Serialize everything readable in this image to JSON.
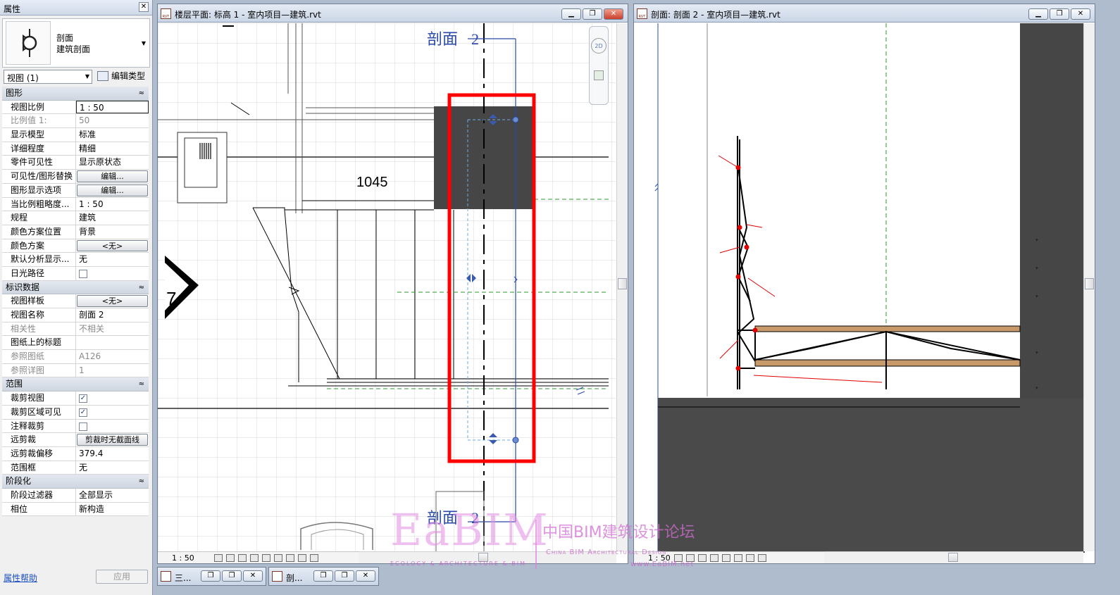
{
  "properties": {
    "title": "属性",
    "type_name_1": "剖面",
    "type_name_2": "建筑剖面",
    "filter": "视图 (1)",
    "edit_type": "编辑类型",
    "sections": [
      {
        "title": "图形",
        "rows": [
          {
            "k": "视图比例",
            "v": "1 : 50",
            "style": "box"
          },
          {
            "k": "比例值 1:",
            "v": "50",
            "style": "dim"
          },
          {
            "k": "显示模型",
            "v": "标准"
          },
          {
            "k": "详细程度",
            "v": "精细"
          },
          {
            "k": "零件可见性",
            "v": "显示原状态"
          },
          {
            "k": "可见性/图形替换",
            "v": "编辑...",
            "style": "btn"
          },
          {
            "k": "图形显示选项",
            "v": "编辑...",
            "style": "btn"
          },
          {
            "k": "当比例粗略度...",
            "v": "1 : 50"
          },
          {
            "k": "规程",
            "v": "建筑"
          },
          {
            "k": "颜色方案位置",
            "v": "背景"
          },
          {
            "k": "颜色方案",
            "v": "<无>",
            "style": "btn"
          },
          {
            "k": "默认分析显示...",
            "v": "无"
          },
          {
            "k": "日光路径",
            "v": "",
            "style": "chk"
          }
        ]
      },
      {
        "title": "标识数据",
        "rows": [
          {
            "k": "视图样板",
            "v": "<无>",
            "style": "btn"
          },
          {
            "k": "视图名称",
            "v": "剖面 2"
          },
          {
            "k": "相关性",
            "v": "不相关",
            "style": "dim"
          },
          {
            "k": "图纸上的标题",
            "v": ""
          },
          {
            "k": "参照图纸",
            "v": "A126",
            "style": "dim"
          },
          {
            "k": "参照详图",
            "v": "1",
            "style": "dim"
          }
        ]
      },
      {
        "title": "范围",
        "rows": [
          {
            "k": "裁剪视图",
            "v": "✓",
            "style": "chk"
          },
          {
            "k": "裁剪区域可见",
            "v": "✓",
            "style": "chk"
          },
          {
            "k": "注释裁剪",
            "v": "",
            "style": "chk"
          },
          {
            "k": "远剪裁",
            "v": "剪裁时无截面线",
            "style": "btn"
          },
          {
            "k": "远剪裁偏移",
            "v": "379.4"
          },
          {
            "k": "范围框",
            "v": "无"
          }
        ]
      },
      {
        "title": "阶段化",
        "rows": [
          {
            "k": "阶段过滤器",
            "v": "全部显示"
          },
          {
            "k": "相位",
            "v": "新构造"
          }
        ]
      }
    ],
    "help": "属性帮助",
    "apply": "应用"
  },
  "plan_view": {
    "title": "楼层平面: 标高 1 - 室内项目—建筑.rvt",
    "scale": "1 : 50",
    "section_label": "剖面",
    "section_number": "2",
    "dimension": "1045",
    "tag": "7",
    "nav_2d": "2D"
  },
  "section_view": {
    "title": "剖面: 剖面 2 - 室内项目—建筑.rvt",
    "scale": "1 : 50"
  },
  "minimized": [
    {
      "title": "三..."
    },
    {
      "title": "剖..."
    }
  ],
  "window_buttons": {
    "minimize": "▁",
    "restore": "❐",
    "close": "✕"
  },
  "watermark": {
    "logo": "EaBIM",
    "sub": "ECOLOGY & ARCHITECTURE & BIM",
    "cn": "中国BIM建筑设计论坛",
    "en": "China BIM Architectural Design",
    "url": "www.EaBIM.net"
  },
  "colors": {
    "highlight": "#ff0000",
    "section_line": "#2a4aa8",
    "dark_fill": "#4a4a4a",
    "wood": "#c89a6a"
  }
}
